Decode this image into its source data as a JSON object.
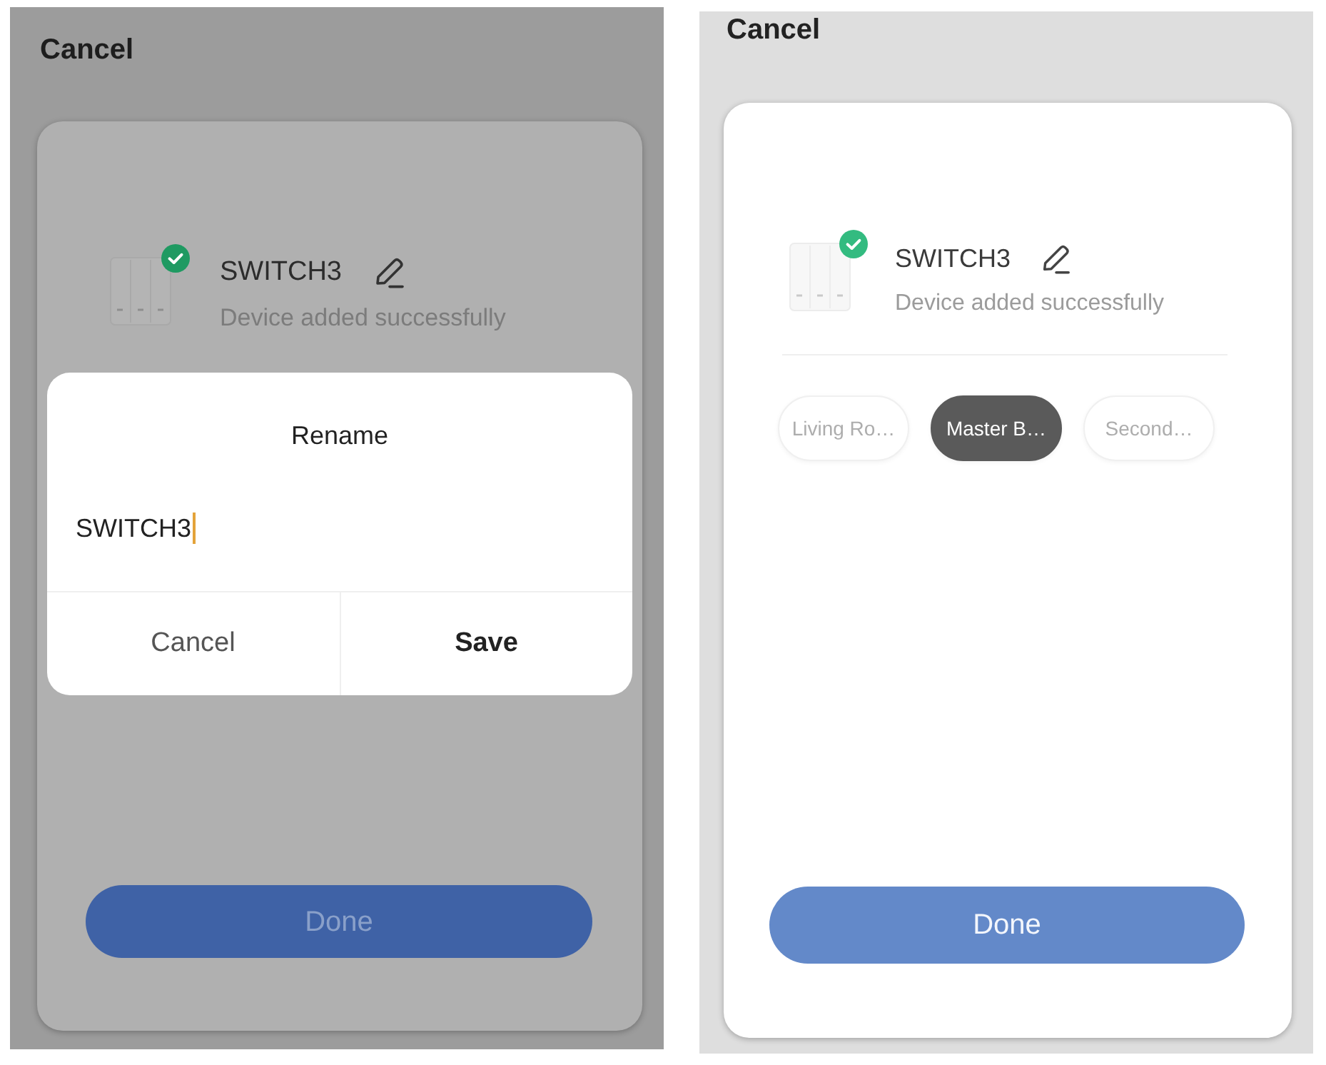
{
  "screens": [
    {
      "dimmed": true,
      "cancel": "Cancel",
      "device": {
        "name": "SWITCH3",
        "status": "Device added successfully"
      },
      "rename_dialog": {
        "title": "Rename",
        "field_value": "SWITCH3",
        "buttons": [
          {
            "label": "Cancel",
            "kind": "cancel"
          },
          {
            "label": "Save",
            "kind": "confirm"
          }
        ]
      },
      "done": "Done"
    },
    {
      "dimmed": false,
      "cancel": "Cancel",
      "device": {
        "name": "SWITCH3",
        "status": "Device added successfully"
      },
      "rooms": [
        {
          "label": "Living Ro…",
          "selected": false
        },
        {
          "label": "Master B…",
          "selected": true
        },
        {
          "label": "Second…",
          "selected": false
        }
      ],
      "done": "Done"
    }
  ]
}
